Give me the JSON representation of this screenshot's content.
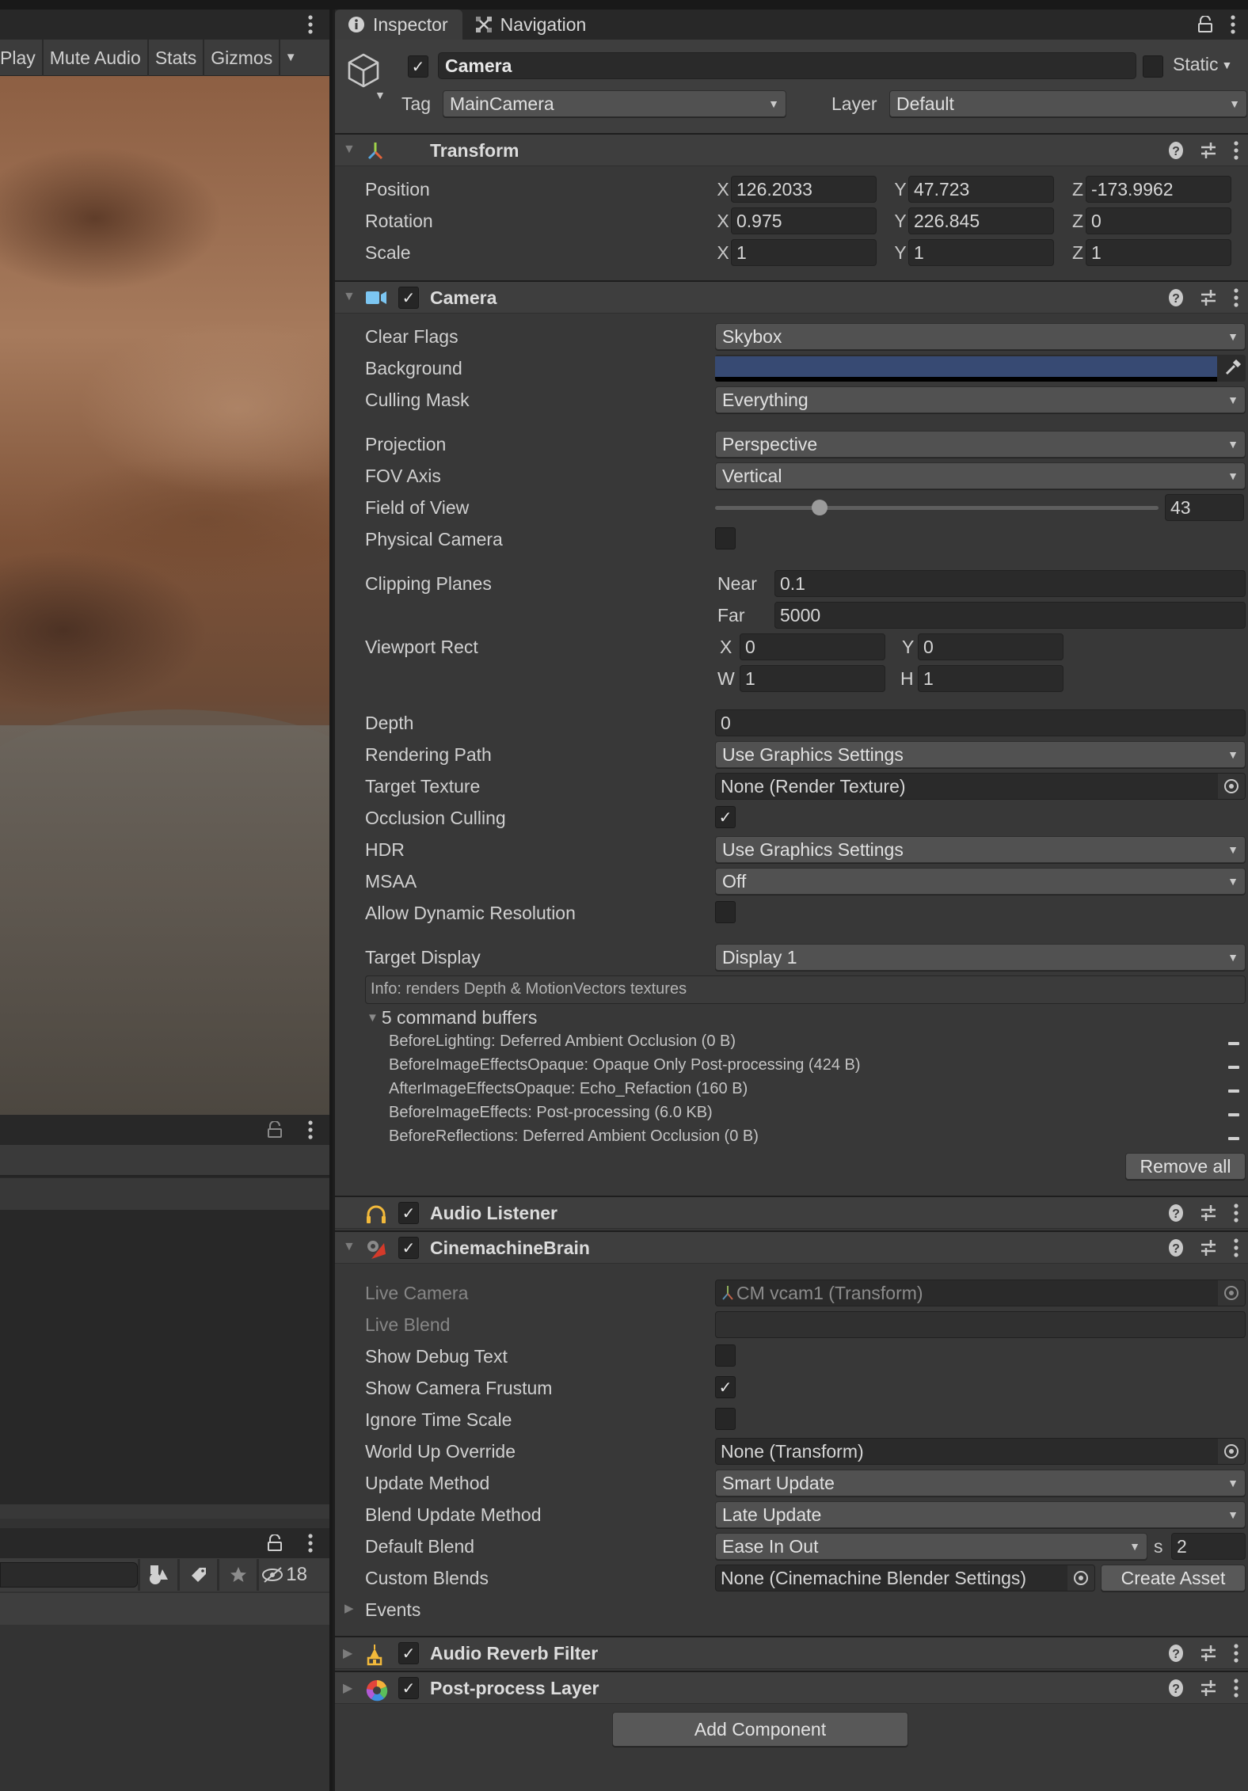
{
  "game_view": {
    "toolbar": [
      {
        "label": "Play",
        "name": "maximize-on-play-toggle"
      },
      {
        "label": "Mute Audio",
        "name": "mute-audio-toggle"
      },
      {
        "label": "Stats",
        "name": "stats-toggle"
      },
      {
        "label": "Gizmos",
        "name": "gizmos-toggle"
      }
    ]
  },
  "project_panel": {
    "hidden_count": "18"
  },
  "inspector": {
    "tabs": [
      {
        "label": "Inspector",
        "icon": "info-icon",
        "active": true
      },
      {
        "label": "Navigation",
        "icon": "navigation-icon",
        "active": false
      }
    ],
    "game_object": {
      "active": true,
      "name": "Camera",
      "static_label": "Static",
      "static": false,
      "tag_label": "Tag",
      "tag": "MainCamera",
      "layer_label": "Layer",
      "layer": "Default"
    },
    "transform": {
      "title": "Transform",
      "rows": [
        {
          "label": "Position",
          "x": "126.2033",
          "y": "47.723",
          "z": "-173.9962"
        },
        {
          "label": "Rotation",
          "x": "0.975",
          "y": "226.845",
          "z": "0"
        },
        {
          "label": "Scale",
          "x": "1",
          "y": "1",
          "z": "1"
        }
      ],
      "axis_labels": [
        "X",
        "Y",
        "Z"
      ]
    },
    "camera": {
      "title": "Camera",
      "enabled": true,
      "clear_flags": {
        "label": "Clear Flags",
        "value": "Skybox"
      },
      "background": {
        "label": "Background",
        "color": "#374a73"
      },
      "culling_mask": {
        "label": "Culling Mask",
        "value": "Everything"
      },
      "projection": {
        "label": "Projection",
        "value": "Perspective"
      },
      "fov_axis": {
        "label": "FOV Axis",
        "value": "Vertical"
      },
      "field_of_view": {
        "label": "Field of View",
        "value": "43",
        "min": 1,
        "max": 179
      },
      "physical_camera": {
        "label": "Physical Camera",
        "checked": false
      },
      "clipping_planes": {
        "label": "Clipping Planes",
        "near_label": "Near",
        "near": "0.1",
        "far_label": "Far",
        "far": "5000"
      },
      "viewport_rect": {
        "label": "Viewport Rect",
        "x_label": "X",
        "x": "0",
        "y_label": "Y",
        "y": "0",
        "w_label": "W",
        "w": "1",
        "h_label": "H",
        "h": "1"
      },
      "depth": {
        "label": "Depth",
        "value": "0"
      },
      "rendering_path": {
        "label": "Rendering Path",
        "value": "Use Graphics Settings"
      },
      "target_texture": {
        "label": "Target Texture",
        "value": "None (Render Texture)"
      },
      "occlusion_culling": {
        "label": "Occlusion Culling",
        "checked": true
      },
      "hdr": {
        "label": "HDR",
        "value": "Use Graphics Settings"
      },
      "msaa": {
        "label": "MSAA",
        "value": "Off"
      },
      "dynamic_resolution": {
        "label": "Allow Dynamic Resolution",
        "checked": false
      },
      "target_display": {
        "label": "Target Display",
        "value": "Display 1"
      },
      "info": "Info: renders Depth & MotionVectors textures",
      "command_buffers_header": "5 command buffers",
      "command_buffers": [
        "BeforeLighting: Deferred Ambient Occlusion (0 B)",
        "BeforeImageEffectsOpaque: Opaque Only Post-processing (424 B)",
        "AfterImageEffectsOpaque: Echo_Refaction (160 B)",
        "BeforeImageEffects: Post-processing (6.0 KB)",
        "BeforeReflections: Deferred Ambient Occlusion (0 B)"
      ],
      "remove_all_label": "Remove all"
    },
    "audio_listener": {
      "title": "Audio Listener",
      "enabled": true
    },
    "cinemachine_brain": {
      "title": "CinemachineBrain",
      "enabled": true,
      "live_camera": {
        "label": "Live Camera",
        "value": "CM vcam1 (Transform)"
      },
      "live_blend": {
        "label": "Live Blend",
        "value": ""
      },
      "show_debug_text": {
        "label": "Show Debug Text",
        "checked": false
      },
      "show_camera_frustum": {
        "label": "Show Camera Frustum",
        "checked": true
      },
      "ignore_time_scale": {
        "label": "Ignore Time Scale",
        "checked": false
      },
      "world_up_override": {
        "label": "World Up Override",
        "value": "None (Transform)"
      },
      "update_method": {
        "label": "Update Method",
        "value": "Smart Update"
      },
      "blend_update_method": {
        "label": "Blend Update Method",
        "value": "Late Update"
      },
      "default_blend": {
        "label": "Default Blend",
        "value": "Ease In Out",
        "seconds_label": "s",
        "seconds": "2"
      },
      "custom_blends": {
        "label": "Custom Blends",
        "value": "None (Cinemachine Blender Settings)",
        "create_label": "Create Asset"
      },
      "events_label": "Events"
    },
    "audio_reverb_filter": {
      "title": "Audio Reverb Filter",
      "enabled": true
    },
    "post_process_layer": {
      "title": "Post-process Layer",
      "enabled": true
    },
    "add_component_label": "Add Component"
  }
}
